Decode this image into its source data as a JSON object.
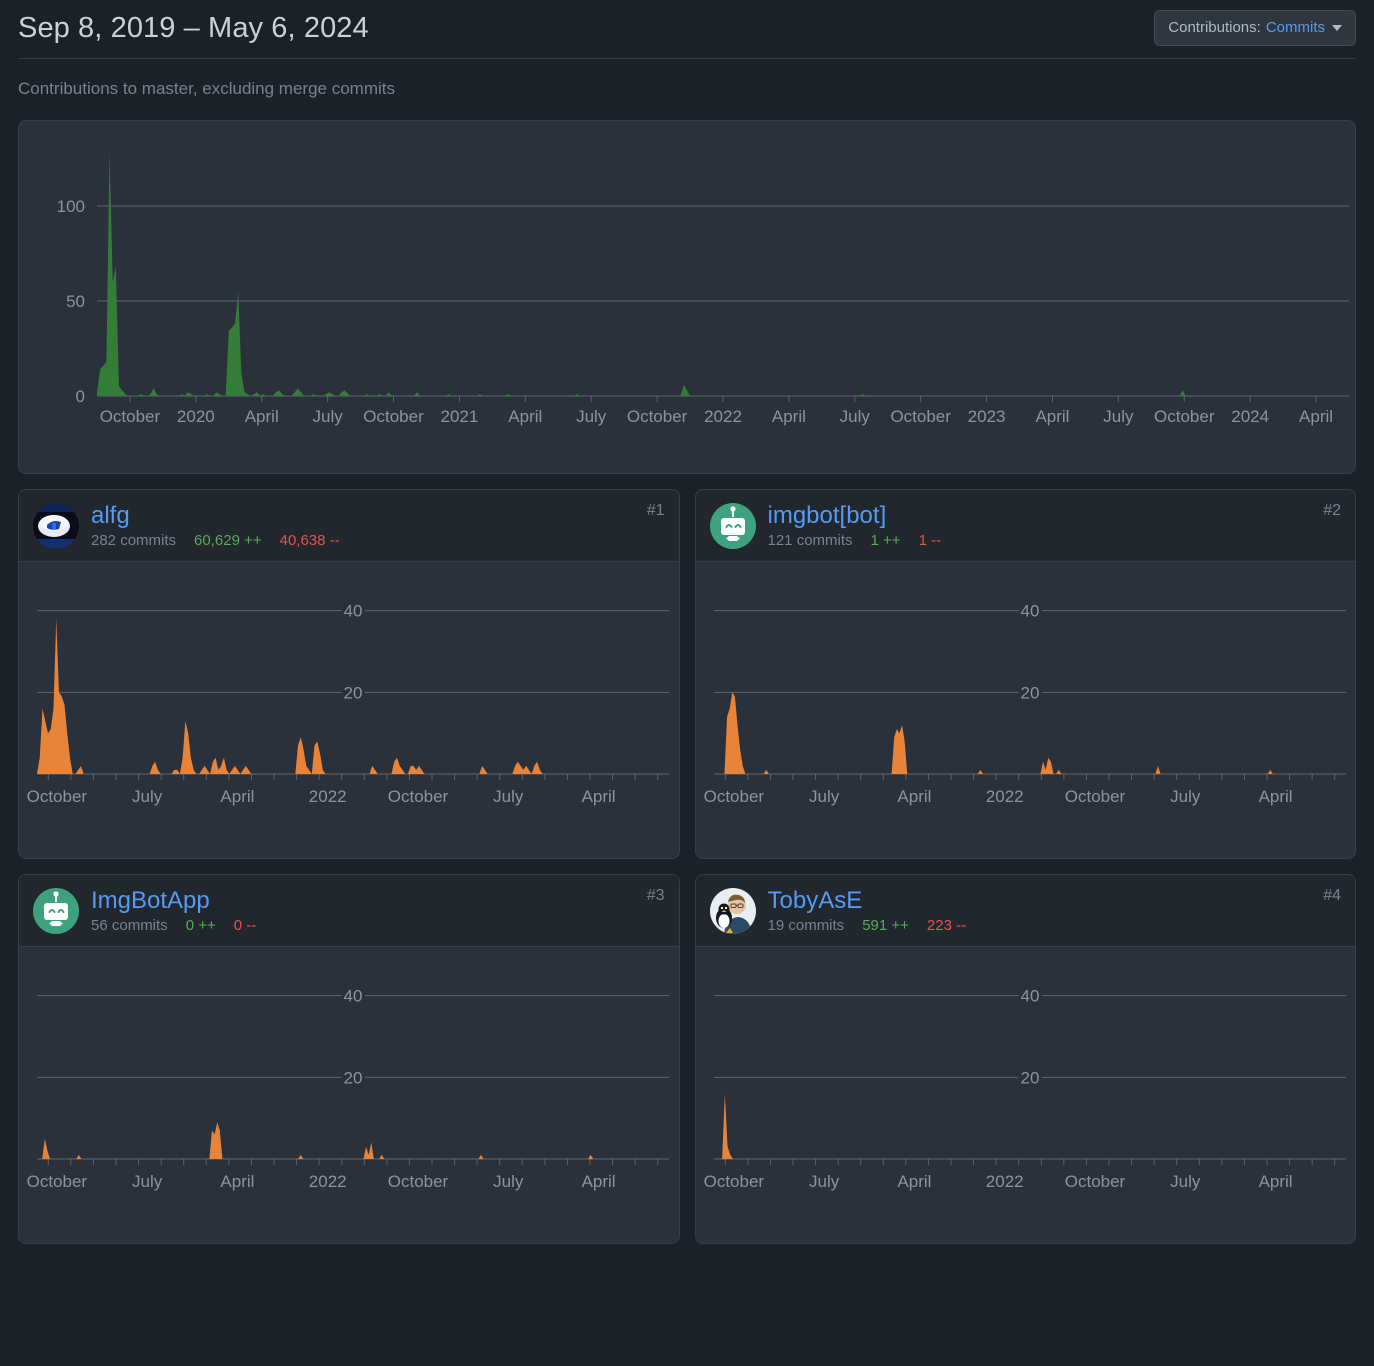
{
  "header": {
    "date_range": "Sep 8, 2019 – May 6, 2024",
    "subtitle": "Contributions to master, excluding merge commits",
    "contributions_button": {
      "prefix": "Contributions:",
      "value": "Commits"
    }
  },
  "chart_data": [
    {
      "id": "overall",
      "type": "area",
      "title": "Contributions to master, excluding merge commits",
      "xlabel": "",
      "ylabel": "",
      "ylim": [
        0,
        130
      ],
      "yticks": [
        0,
        50,
        100
      ],
      "grid": true,
      "legend": "none",
      "color": "#347d39",
      "tick_labels": [
        "October",
        "2020",
        "April",
        "July",
        "October",
        "2021",
        "April",
        "July",
        "October",
        "2022",
        "April",
        "July",
        "October",
        "2023",
        "April",
        "July",
        "October",
        "2024",
        "April"
      ],
      "values": [
        2,
        14,
        16,
        18,
        128,
        60,
        68,
        5,
        3,
        1,
        0,
        0,
        0,
        0,
        1,
        0,
        0,
        1,
        4,
        1,
        0,
        0,
        0,
        0,
        0,
        0,
        0,
        1,
        0,
        2,
        1,
        0,
        0,
        0,
        0,
        1,
        0,
        0,
        2,
        1,
        0,
        0,
        34,
        36,
        38,
        55,
        12,
        2,
        1,
        0,
        1,
        2,
        0,
        1,
        0,
        0,
        0,
        2,
        3,
        1,
        0,
        0,
        0,
        2,
        4,
        2,
        0,
        0,
        0,
        1,
        0,
        0,
        0,
        1,
        2,
        1,
        0,
        0,
        2,
        3,
        1,
        0,
        0,
        0,
        0,
        0,
        1,
        0,
        0,
        0,
        1,
        0,
        0,
        2,
        0,
        0,
        0,
        0,
        0,
        0,
        0,
        0,
        2,
        0,
        0,
        0,
        0,
        0,
        0,
        0,
        0,
        0,
        1,
        0,
        0,
        0,
        0,
        0,
        0,
        0,
        0,
        0,
        1,
        0,
        0,
        0,
        0,
        0,
        0,
        0,
        0,
        1,
        0,
        0,
        0,
        0,
        0,
        0,
        0,
        0,
        0,
        0,
        0,
        0,
        0,
        0,
        0,
        0,
        0,
        0,
        0,
        0,
        0,
        1,
        0,
        0,
        0,
        0,
        0,
        0,
        0,
        0,
        0,
        0,
        0,
        0,
        0,
        0,
        0,
        0,
        0,
        0,
        0,
        0,
        0,
        0,
        0,
        0,
        0,
        0,
        0,
        0,
        0,
        0,
        0,
        0,
        0,
        6,
        3,
        0,
        0,
        0,
        0,
        0,
        0,
        0,
        0,
        0,
        0,
        0,
        0,
        0,
        0,
        0,
        0,
        0,
        0,
        0,
        0,
        0,
        0,
        0,
        0,
        0,
        0,
        0,
        0,
        0,
        0,
        0,
        0,
        0,
        0,
        0,
        0,
        0,
        0,
        0,
        0,
        0,
        0,
        0,
        0,
        0,
        0,
        0,
        0,
        0,
        0,
        0,
        0,
        0,
        0,
        0,
        1,
        0,
        0,
        0,
        0,
        0,
        0,
        0,
        0,
        0,
        0,
        0,
        0,
        0,
        0,
        0,
        0,
        0,
        0,
        0,
        0,
        0,
        0,
        0,
        0,
        0,
        0,
        0,
        0,
        0,
        0,
        0,
        0,
        0,
        0,
        0,
        0,
        0,
        0,
        0,
        0,
        0,
        0,
        0,
        0,
        0,
        0,
        0,
        0,
        0,
        0,
        0,
        0,
        0,
        0,
        0,
        0,
        0,
        0,
        0,
        0,
        0,
        0,
        0,
        0,
        0,
        0,
        0,
        0,
        0,
        0,
        0,
        0,
        0,
        0,
        0,
        0,
        0,
        0,
        0,
        0,
        0,
        0,
        0,
        0,
        0,
        0,
        0,
        0,
        0,
        0,
        0,
        0,
        0,
        0,
        0,
        0,
        0,
        0,
        0,
        0,
        0,
        3,
        0,
        0,
        0,
        0,
        0,
        0,
        0,
        0,
        0,
        0,
        0,
        0,
        0,
        0,
        0,
        0,
        0,
        0,
        0,
        0,
        0,
        0,
        0,
        0,
        0,
        0,
        0,
        0,
        0,
        0,
        0,
        0,
        0,
        0,
        0,
        0,
        0,
        0,
        0,
        0,
        0,
        0,
        0,
        0,
        0,
        0,
        0,
        0,
        0,
        0,
        0,
        0,
        0
      ]
    },
    {
      "id": "alfg",
      "type": "area",
      "ylim": [
        0,
        48
      ],
      "yticks": [
        20,
        40
      ],
      "grid": true,
      "color": "#e8833a",
      "tick_labels": [
        "October",
        "July",
        "April",
        "2022",
        "October",
        "July",
        "April"
      ],
      "values": [
        0,
        4,
        16,
        13,
        10,
        11,
        16,
        38,
        20,
        19,
        17,
        10,
        4,
        0,
        0,
        1,
        2,
        0,
        0,
        0,
        0,
        0,
        0,
        0,
        0,
        0,
        0,
        0,
        0,
        0,
        0,
        0,
        0,
        0,
        0,
        0,
        0,
        0,
        0,
        0,
        0,
        0,
        2,
        3,
        1,
        0,
        0,
        0,
        0,
        0,
        1,
        1,
        0,
        4,
        13,
        10,
        4,
        1,
        0,
        0,
        1,
        2,
        1,
        0,
        3,
        4,
        1,
        2,
        4,
        1,
        0,
        1,
        2,
        1,
        0,
        1,
        2,
        1,
        0,
        0,
        0,
        0,
        0,
        0,
        0,
        0,
        0,
        0,
        0,
        0,
        0,
        0,
        0,
        0,
        0,
        7,
        9,
        6,
        2,
        1,
        0,
        7,
        8,
        5,
        1,
        0,
        0,
        0,
        0,
        0,
        0,
        0,
        0,
        0,
        0,
        0,
        0,
        0,
        0,
        0,
        0,
        0,
        2,
        1,
        0,
        0,
        0,
        0,
        0,
        0,
        3,
        4,
        2,
        1,
        0,
        0,
        2,
        2,
        1,
        2,
        1,
        0,
        0,
        0,
        0,
        0,
        0,
        0,
        0,
        0,
        0,
        0,
        0,
        0,
        0,
        0,
        0,
        0,
        0,
        0,
        0,
        0,
        2,
        1,
        0,
        0,
        0,
        0,
        0,
        0,
        0,
        0,
        0,
        0,
        2,
        3,
        2,
        1,
        2,
        1,
        0,
        2,
        3,
        1,
        0,
        0,
        0,
        0,
        0,
        0,
        0,
        0,
        0,
        0,
        0,
        0,
        0,
        0,
        0,
        0,
        0,
        0,
        0,
        0,
        0,
        0,
        0,
        0,
        0,
        0,
        0,
        0,
        0,
        0,
        0,
        0,
        0,
        0,
        0,
        0,
        0,
        0,
        0,
        0,
        0,
        0,
        0,
        0,
        0,
        0,
        0
      ]
    },
    {
      "id": "imgbot[bot]",
      "type": "area",
      "ylim": [
        0,
        48
      ],
      "yticks": [
        20,
        40
      ],
      "grid": true,
      "color": "#e8833a",
      "tick_labels": [
        "October",
        "July",
        "April",
        "2022",
        "October",
        "July",
        "April"
      ],
      "values": [
        0,
        0,
        0,
        0,
        0,
        14,
        16,
        20,
        19,
        12,
        6,
        2,
        0,
        0,
        0,
        0,
        0,
        0,
        0,
        0,
        1,
        0,
        0,
        0,
        0,
        0,
        0,
        0,
        0,
        0,
        0,
        0,
        0,
        0,
        0,
        0,
        0,
        0,
        0,
        0,
        0,
        0,
        0,
        0,
        0,
        0,
        0,
        0,
        0,
        0,
        0,
        0,
        0,
        0,
        0,
        0,
        0,
        0,
        0,
        0,
        0,
        0,
        0,
        0,
        0,
        0,
        0,
        0,
        0,
        9,
        11,
        10,
        12,
        8,
        0,
        0,
        0,
        0,
        0,
        0,
        0,
        0,
        0,
        0,
        0,
        0,
        0,
        0,
        0,
        0,
        0,
        0,
        0,
        0,
        0,
        0,
        0,
        0,
        0,
        0,
        0,
        0,
        1,
        0,
        0,
        0,
        0,
        0,
        0,
        0,
        0,
        0,
        0,
        0,
        0,
        0,
        0,
        0,
        0,
        0,
        0,
        0,
        0,
        0,
        0,
        0,
        3,
        1,
        4,
        3,
        0,
        0,
        1,
        0,
        0,
        0,
        0,
        0,
        0,
        0,
        0,
        0,
        0,
        0,
        0,
        0,
        0,
        0,
        0,
        0,
        0,
        0,
        0,
        0,
        0,
        0,
        0,
        0,
        0,
        0,
        0,
        0,
        0,
        0,
        0,
        0,
        0,
        0,
        0,
        0,
        2,
        0,
        0,
        0,
        0,
        0,
        0,
        0,
        0,
        0,
        0,
        0,
        0,
        0,
        0,
        0,
        0,
        0,
        0,
        0,
        0,
        0,
        0,
        0,
        0,
        0,
        0,
        0,
        0,
        0,
        0,
        0,
        0,
        0,
        0,
        0,
        0,
        0,
        0,
        0,
        0,
        0,
        0,
        1,
        0,
        0,
        0,
        0,
        0,
        0,
        0,
        0,
        0,
        0,
        0,
        0,
        0,
        0,
        0,
        0,
        0,
        0,
        0,
        0,
        0,
        0,
        0,
        0,
        0,
        0,
        0,
        0,
        0
      ]
    },
    {
      "id": "ImgBotApp",
      "type": "area",
      "ylim": [
        0,
        48
      ],
      "yticks": [
        20,
        40
      ],
      "grid": true,
      "color": "#e8833a",
      "tick_labels": [
        "October",
        "July",
        "April",
        "2022",
        "October",
        "July",
        "April"
      ],
      "values": [
        0,
        0,
        0,
        5,
        2,
        0,
        0,
        0,
        0,
        0,
        0,
        0,
        0,
        0,
        0,
        0,
        1,
        0,
        0,
        0,
        0,
        0,
        0,
        0,
        0,
        0,
        0,
        0,
        0,
        0,
        0,
        0,
        0,
        0,
        0,
        0,
        0,
        0,
        0,
        0,
        0,
        0,
        0,
        0,
        0,
        0,
        0,
        0,
        0,
        0,
        0,
        0,
        0,
        0,
        0,
        0,
        0,
        0,
        0,
        0,
        0,
        0,
        0,
        0,
        0,
        0,
        0,
        7,
        6,
        9,
        7,
        0,
        0,
        0,
        0,
        0,
        0,
        0,
        0,
        0,
        0,
        0,
        0,
        0,
        0,
        0,
        0,
        0,
        0,
        0,
        0,
        0,
        0,
        0,
        0,
        0,
        0,
        0,
        0,
        0,
        0,
        1,
        0,
        0,
        0,
        0,
        0,
        0,
        0,
        0,
        0,
        0,
        0,
        0,
        0,
        0,
        0,
        0,
        0,
        0,
        0,
        0,
        0,
        0,
        0,
        0,
        3,
        1,
        4,
        0,
        0,
        0,
        1,
        0,
        0,
        0,
        0,
        0,
        0,
        0,
        0,
        0,
        0,
        0,
        0,
        0,
        0,
        0,
        0,
        0,
        0,
        0,
        0,
        0,
        0,
        0,
        0,
        0,
        0,
        0,
        0,
        0,
        0,
        0,
        0,
        0,
        0,
        0,
        0,
        0,
        1,
        0,
        0,
        0,
        0,
        0,
        0,
        0,
        0,
        0,
        0,
        0,
        0,
        0,
        0,
        0,
        0,
        0,
        0,
        0,
        0,
        0,
        0,
        0,
        0,
        0,
        0,
        0,
        0,
        0,
        0,
        0,
        0,
        0,
        0,
        0,
        0,
        0,
        0,
        0,
        0,
        0,
        1,
        0,
        0,
        0,
        0,
        0,
        0,
        0,
        0,
        0,
        0,
        0,
        0,
        0,
        0,
        0,
        0,
        0,
        0,
        0,
        0,
        0,
        0,
        0,
        0,
        0,
        0,
        0,
        0,
        0,
        0
      ]
    },
    {
      "id": "TobyAsE",
      "type": "area",
      "ylim": [
        0,
        48
      ],
      "yticks": [
        20,
        40
      ],
      "grid": true,
      "color": "#e8833a",
      "tick_labels": [
        "October",
        "July",
        "April",
        "2022",
        "October",
        "July",
        "April"
      ],
      "values": [
        0,
        0,
        0,
        0,
        16,
        3,
        1,
        0,
        0,
        0,
        0,
        0,
        0,
        0,
        0,
        0,
        0,
        0,
        0,
        0,
        0,
        0,
        0,
        0,
        0,
        0,
        0,
        0,
        0,
        0,
        0,
        0,
        0,
        0,
        0,
        0,
        0,
        0,
        0,
        0,
        0,
        0,
        0,
        0,
        0,
        0,
        0,
        0,
        0,
        0,
        0,
        0,
        0,
        0,
        0,
        0,
        0,
        0,
        0,
        0,
        0,
        0,
        0,
        0,
        0,
        0,
        0,
        0,
        0,
        0,
        0,
        0,
        0,
        0,
        0,
        0,
        0,
        0,
        0,
        0,
        0,
        0,
        0,
        0,
        0,
        0,
        0,
        0,
        0,
        0,
        0,
        0,
        0,
        0,
        0,
        0,
        0,
        0,
        0,
        0,
        0,
        0,
        0,
        0,
        0,
        0,
        0,
        0,
        0,
        0,
        0,
        0,
        0,
        0,
        0,
        0,
        0,
        0,
        0,
        0,
        0,
        0,
        0,
        0,
        0,
        0,
        0,
        0,
        0,
        0,
        0,
        0,
        0,
        0,
        0,
        0,
        0,
        0,
        0,
        0,
        0,
        0,
        0,
        0,
        0,
        0,
        0,
        0,
        0,
        0,
        0,
        0,
        0,
        0,
        0,
        0,
        0,
        0,
        0,
        0,
        0,
        0,
        0,
        0,
        0,
        0,
        0,
        0,
        0,
        0,
        0,
        0,
        0,
        0,
        0,
        0,
        0,
        0,
        0,
        0,
        0,
        0,
        0,
        0,
        0,
        0,
        0,
        0,
        0,
        0,
        0,
        0,
        0,
        0,
        0,
        0,
        0,
        0,
        0,
        0,
        0,
        0,
        0,
        0,
        0,
        0,
        0,
        0,
        0,
        0,
        0,
        0,
        0,
        0,
        0,
        0,
        0,
        0,
        0,
        0,
        0,
        0,
        0,
        0,
        0,
        0,
        0,
        0,
        0,
        0,
        0,
        0,
        0,
        0
      ]
    }
  ],
  "contributors": [
    {
      "login": "alfg",
      "commits": "282 commits",
      "additions": "60,629 ++",
      "deletions": "40,638 --",
      "rank": "#1",
      "avatar_kind": "photo-helmet"
    },
    {
      "login": "imgbot[bot]",
      "commits": "121 commits",
      "additions": "1 ++",
      "deletions": "1 --",
      "rank": "#2",
      "avatar_kind": "robot-green"
    },
    {
      "login": "ImgBotApp",
      "commits": "56 commits",
      "additions": "0 ++",
      "deletions": "0 --",
      "rank": "#3",
      "avatar_kind": "robot-green"
    },
    {
      "login": "TobyAsE",
      "commits": "19 commits",
      "additions": "591 ++",
      "deletions": "223 --",
      "rank": "#4",
      "avatar_kind": "photo-person"
    }
  ],
  "colors": {
    "page_bg": "#1c2128",
    "panel_bg": "#2b313b",
    "accent_link": "#539bf5",
    "additions": "#57ab5a",
    "deletions": "#e5534b",
    "overall_area": "#347d39",
    "spark_area": "#e8833a",
    "muted_text": "#768390"
  }
}
